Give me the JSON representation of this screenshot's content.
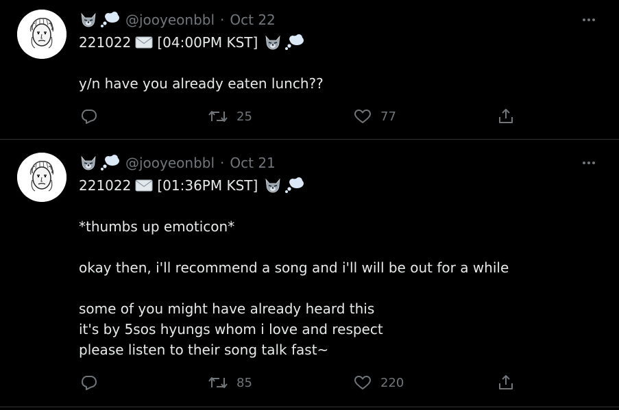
{
  "tweets": [
    {
      "handle": "@jooyeonbbl",
      "separator": "·",
      "date": "Oct 22",
      "title_prefix": "221022",
      "title_time": "[04:00PM KST]",
      "lines": [
        "y/n have you already eaten lunch??"
      ],
      "retweets": "25",
      "likes": "77"
    },
    {
      "handle": "@jooyeonbbl",
      "separator": "·",
      "date": "Oct 21",
      "title_prefix": "221022",
      "title_time": "[01:36PM KST]",
      "lines": [
        "*thumbs up emoticon*",
        "",
        "okay then, i'll recommend a song and i'll will be out for a while",
        "",
        "some of you might have already heard this",
        "it's by 5sos hyungs whom i love and respect",
        "please listen to their song talk fast~"
      ],
      "retweets": "85",
      "likes": "220"
    }
  ],
  "icons": {
    "avatar": "avatar-drawing",
    "name_emoji": [
      "wolf-emoji",
      "thought-balloon-emoji"
    ],
    "title_emoji": "envelope-emoji",
    "more": "more-icon",
    "reply": "reply-icon",
    "retweet": "retweet-icon",
    "like": "heart-icon",
    "share": "share-icon"
  },
  "colors": {
    "background": "#000000",
    "text": "#e7e9ea",
    "muted": "#71767b",
    "divider": "#2f3336"
  }
}
